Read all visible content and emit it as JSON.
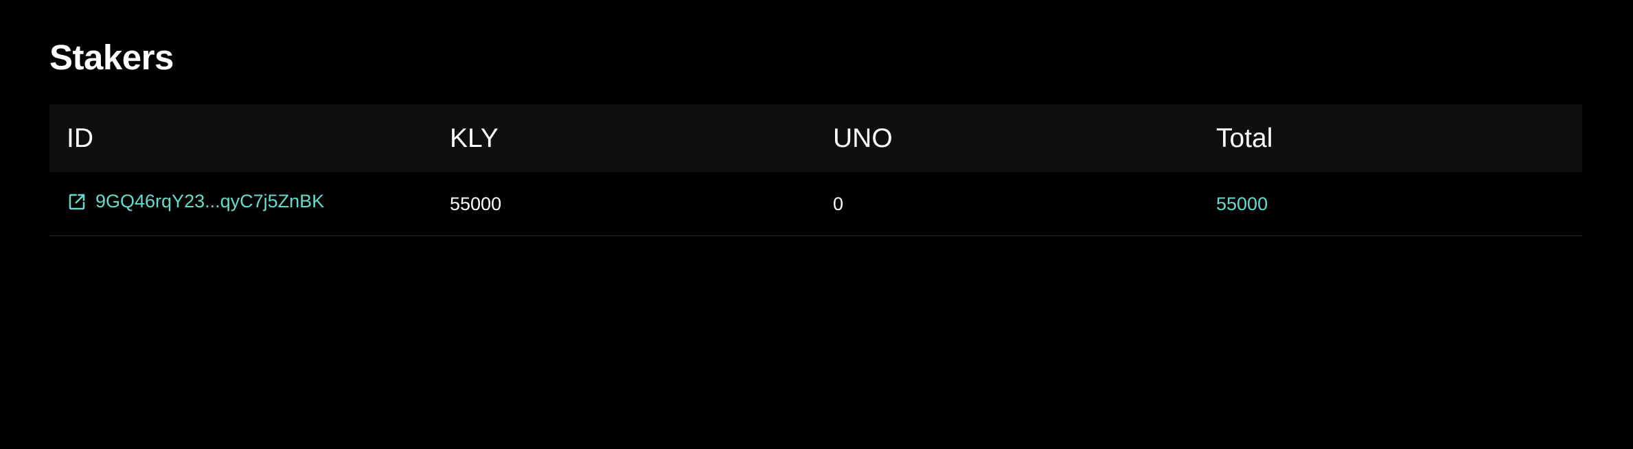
{
  "page": {
    "title": "Stakers"
  },
  "colors": {
    "background": "#000000",
    "header_bg": "#0f0f0f",
    "accent": "#64dccd",
    "divider": "#2b2b2b"
  },
  "table": {
    "columns": [
      "ID",
      "KLY",
      "UNO",
      "Total"
    ],
    "rows": [
      {
        "id": "9GQ46rqY23...qyC7j5ZnBK",
        "id_icon": "external-link-icon",
        "kly": "55000",
        "uno": "0",
        "total": "55000"
      }
    ]
  }
}
